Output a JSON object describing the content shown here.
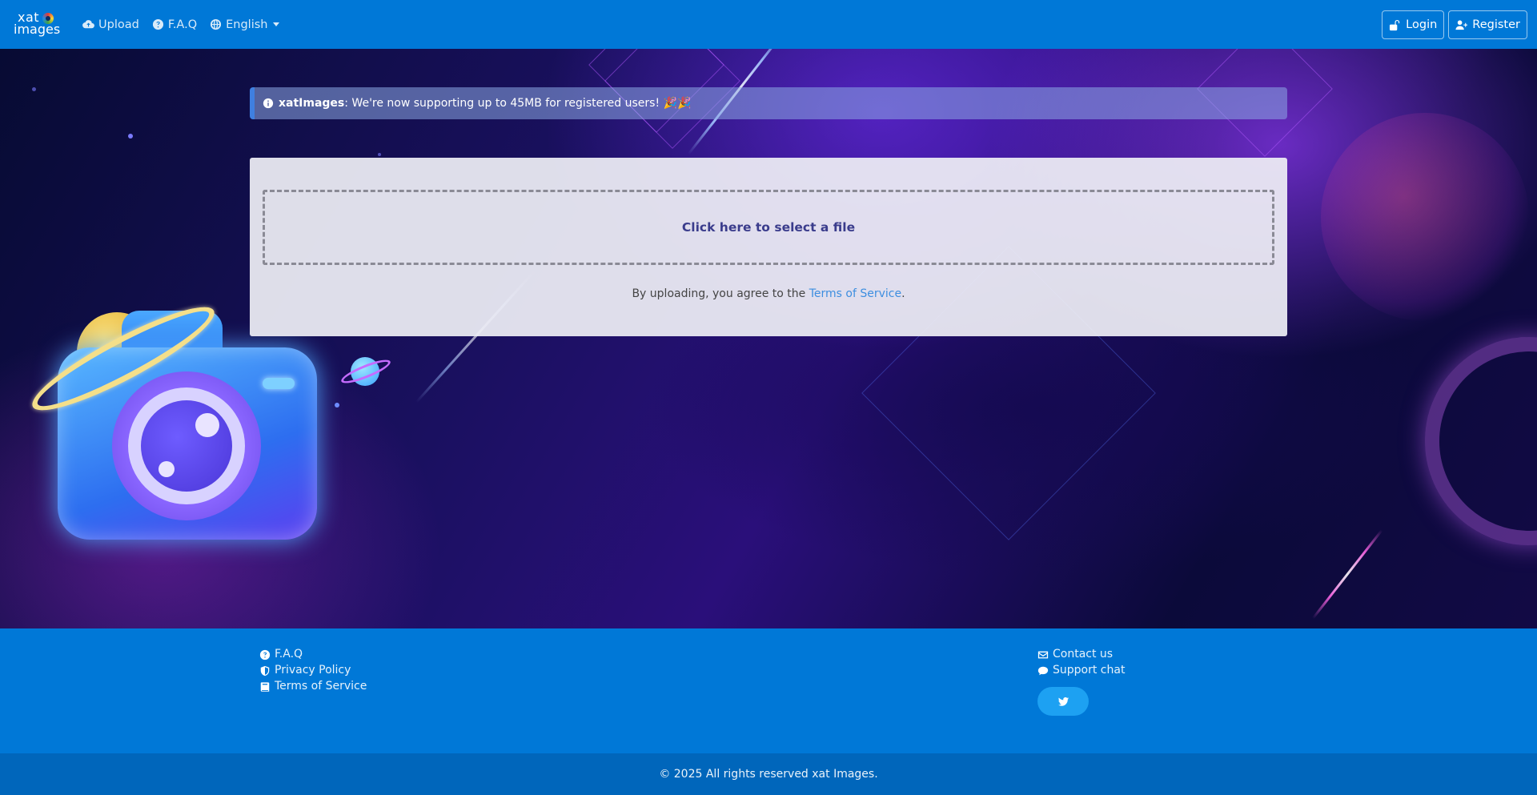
{
  "brand": {
    "logo_line1": "xat",
    "logo_line2": "images"
  },
  "nav": {
    "upload": "Upload",
    "faq": "F.A.Q",
    "language": "English",
    "login": "Login",
    "register": "Register"
  },
  "alert": {
    "brand": "xatImages",
    "message": ": We're now supporting up to 45MB for registered users! 🎉🎉"
  },
  "upload_card": {
    "select_file": "Click here to select a file",
    "tos_prefix": "By uploading, you agree to the ",
    "tos_link": "Terms of Service",
    "tos_suffix": "."
  },
  "footer": {
    "left": [
      {
        "icon": "question-circle-icon",
        "label": "F.A.Q"
      },
      {
        "icon": "shield-icon",
        "label": "Privacy Policy"
      },
      {
        "icon": "book-icon",
        "label": "Terms of Service"
      }
    ],
    "right": [
      {
        "icon": "envelope-icon",
        "label": "Contact us"
      },
      {
        "icon": "chat-bubble-icon",
        "label": "Support chat"
      }
    ],
    "social": "twitter-icon",
    "copyright": "© 2025 All rights reserved xat Images."
  },
  "colors": {
    "primary": "#0078d7",
    "footer_bottom": "#0066bb",
    "link": "#3d8ee0",
    "dropzone_text": "#3a3c8c",
    "twitter": "#1da1f2"
  }
}
